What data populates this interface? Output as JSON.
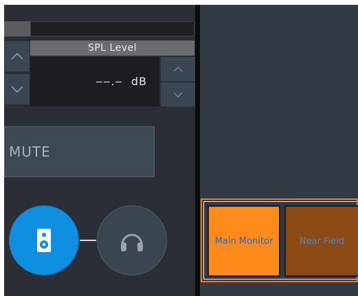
{
  "spl": {
    "label": "SPL Level",
    "value": "‒‒.‒",
    "unit": "dB"
  },
  "mute": {
    "label": "MUTE"
  },
  "output": {
    "speaker_active": true,
    "headphone_active": false
  },
  "monitors": {
    "selected": "Main Monitor",
    "items": [
      {
        "label": "Main Monitor",
        "selected": true
      },
      {
        "label": "Near Field",
        "selected": false
      }
    ]
  },
  "colors": {
    "accent_blue": "#0e8fe0",
    "accent_orange": "#ff8a1c",
    "orange_dark": "#8c4a14",
    "panel": "#2b2e34",
    "panel_right": "#333a44"
  },
  "icons": {
    "up": "chevron-up-icon",
    "down": "chevron-down-icon",
    "speaker": "speaker-icon",
    "headphone": "headphones-icon"
  }
}
